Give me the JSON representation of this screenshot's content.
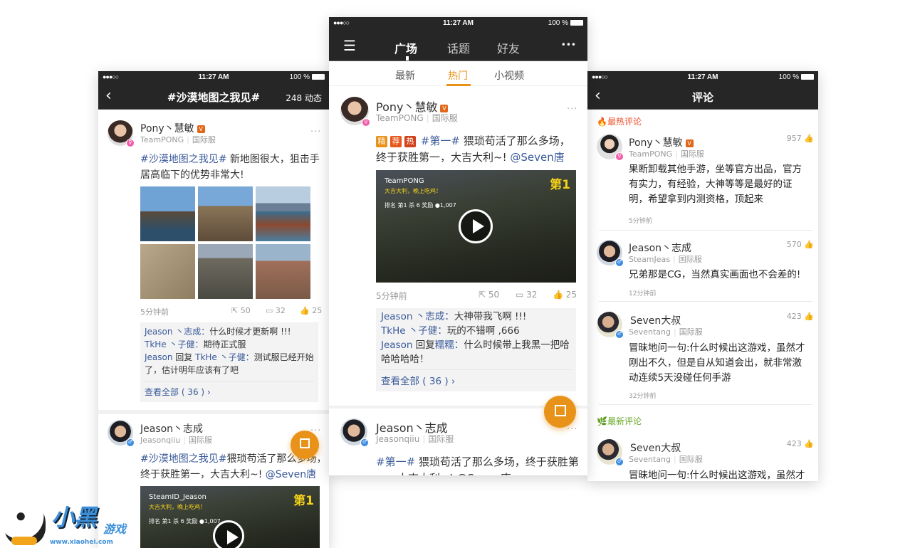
{
  "status": {
    "signal": "●●●○○",
    "time": "11:27 AM",
    "battery": "100 %"
  },
  "left": {
    "back": "‹",
    "title": "#沙漠地图之我见#",
    "count": "248 动态",
    "post1": {
      "name": "Pony丶慧敏",
      "v": "V",
      "team": "TeamPONG",
      "server": "国际服",
      "more": "···",
      "tag": "#沙漠地图之我见#",
      "text": " 新地图很大，狙击手居高临下的优势非常大!",
      "time": "5分钟前",
      "shares": "50",
      "comments": "32",
      "likes": "25",
      "c1u": "Jeason 丶志成：",
      "c1": "什么时候才更新啊 !!!",
      "c2u": "TkHe 丶子健：",
      "c2": "期待正式服",
      "c3u": "Jeason",
      "c3r": " 回复 ",
      "c3u2": "TkHe 丶子健：",
      "c3": "测试服已经开始了，估计明年应该有了吧",
      "all": "查看全部 ( 36 )  ›"
    },
    "post2": {
      "name": "Jeason丶志成",
      "team": "Jeasonqiiu",
      "server": "国际服",
      "more": "···",
      "tag": "#沙漠地图之我见#",
      "text": "猥琐苟活了那么多场，终于获胜第一，大吉大利~! ",
      "at": "@Seven唐",
      "video": {
        "player": "SteamID_Jeason",
        "slogan": "大吉大利，晚上吃鸡！",
        "stats": "排名 第1   杀 6   奖励 ●1,007",
        "rank": "第1"
      }
    }
  },
  "middle": {
    "nav": {
      "tabs": [
        "广场",
        "话题",
        "好友"
      ],
      "more": "•••"
    },
    "subtabs": [
      "最新",
      "热门",
      "小视频"
    ],
    "post1": {
      "name": "Pony丶慧敏",
      "v": "V",
      "team": "TeamPONG",
      "server": "国际服",
      "more": "···",
      "labels": [
        "精",
        "荐",
        "热"
      ],
      "tag": "#第一#",
      "text": " 猥琐苟活了那么多场，终于获胜第一，大吉大利~! ",
      "at": "@Seven唐",
      "video": {
        "player": "TeamPONG",
        "slogan": "大吉大利，晚上吃鸡！",
        "stats": "排名 第1   杀 6   奖励 ●1,007",
        "rank": "第1"
      },
      "time": "5分钟前",
      "shares": "50",
      "comments": "32",
      "likes": "25",
      "c1u": "Jeason 丶志成：",
      "c1": "大神带我飞啊 !!!",
      "c2u": "TkHe 丶子健：",
      "c2": "玩的不错啊 ,666",
      "c3u": "Jeason",
      "c3r": " 回复",
      "c3u2": "糯糯：",
      "c3": "什么时候带上我黑一把哈哈哈哈哈！",
      "all": "查看全部 ( 36 )  ›"
    },
    "post2": {
      "name": "Jeason丶志成",
      "team": "Jeasonqiiu",
      "server": "国际服",
      "more": "···",
      "tag": "#第一#",
      "text": " 猥琐苟活了那么多场，终于获胜第一，大吉大利~! @Seven唐"
    }
  },
  "right": {
    "back": "‹",
    "title": "评论",
    "hot": "最热评论",
    "new": "最新评论",
    "comments": [
      {
        "name": "Pony丶慧敏",
        "v": "V",
        "team": "TeamPONG",
        "server": "国际服",
        "likes": "957",
        "text": "果断卸载其他手游，坐等官方出品，官方有实力，有经验，大神等等是最好的证明，希望拿到内测资格，顶起来",
        "time": "5分钟前"
      },
      {
        "name": "Jeason丶志成",
        "team": "SteamJeas",
        "server": "国际服",
        "likes": "570",
        "text": "兄弟那是CG，当然真实画面也不会差的!",
        "time": "12分钟前"
      },
      {
        "name": "Seven大叔",
        "team": "Seventang",
        "server": "国际服",
        "likes": "423",
        "text": "冒昧地问一句:什么时候出这游戏，虽然才刚出不久，但是自从知道会出，就非常激动连续5天没碰任何手游",
        "time": "32分钟前"
      },
      {
        "name": "Seven大叔",
        "team": "Seventang",
        "server": "国际服",
        "likes": "423",
        "text": "冒昧地问一句:什么时候出这游戏，虽然才"
      }
    ]
  },
  "watermark": {
    "brand": "小黑游戏",
    "url": "www.xiaohei.com"
  },
  "colors": {
    "accent": "#e8921a",
    "header": "#262626",
    "link": "#3a5a9a",
    "hot": "#f0502a",
    "new": "#6aaa2a"
  }
}
